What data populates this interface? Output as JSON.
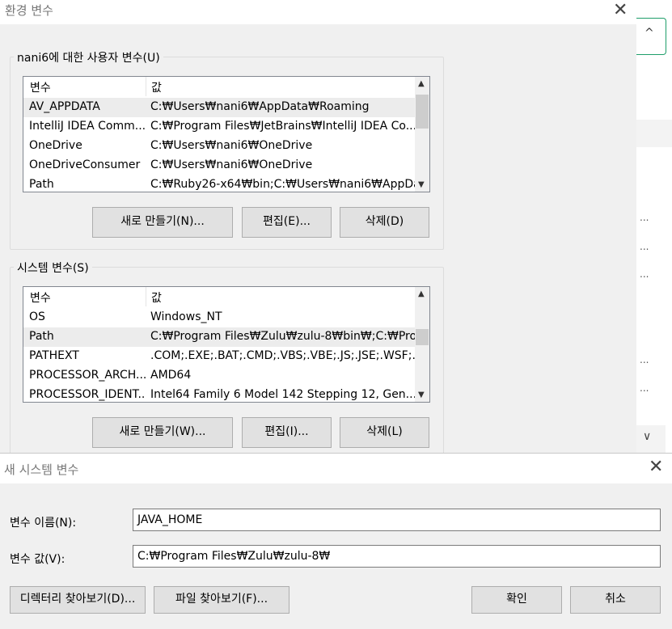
{
  "env_dialog": {
    "title": "환경 변수",
    "close_glyph": "✕",
    "user_group": {
      "label": "nani6에 대한 사용자 변수(U)",
      "columns": [
        "변수",
        "값"
      ],
      "rows": [
        {
          "name": "AV_APPDATA",
          "value": "C:₩Users₩nani6₩AppData₩Roaming"
        },
        {
          "name": "IntelliJ IDEA Comm...",
          "value": "C:₩Program Files₩JetBrains₩IntelliJ IDEA Co..."
        },
        {
          "name": "OneDrive",
          "value": "C:₩Users₩nani6₩OneDrive"
        },
        {
          "name": "OneDriveConsumer",
          "value": "C:₩Users₩nani6₩OneDrive"
        },
        {
          "name": "Path",
          "value": "C:₩Ruby26-x64₩bin;C:₩Users₩nani6₩AppDa..."
        }
      ],
      "buttons": {
        "new": "새로 만들기(N)...",
        "edit": "편집(E)...",
        "delete": "삭제(D)"
      }
    },
    "system_group": {
      "label": "시스템 변수(S)",
      "columns": [
        "변수",
        "값"
      ],
      "rows": [
        {
          "name": "OS",
          "value": "Windows_NT"
        },
        {
          "name": "Path",
          "value": "C:₩Program Files₩Zulu₩zulu-8₩bin₩;C:₩Pro..."
        },
        {
          "name": "PATHEXT",
          "value": ".COM;.EXE;.BAT;.CMD;.VBS;.VBE;.JS;.JSE;.WSF;..."
        },
        {
          "name": "PROCESSOR_ARCH...",
          "value": "AMD64"
        },
        {
          "name": "PROCESSOR_IDENT...",
          "value": "Intel64 Family 6 Model 142 Stepping 12, Gen..."
        }
      ],
      "buttons": {
        "new": "새로 만들기(W)...",
        "edit": "편집(I)...",
        "delete": "삭제(L)"
      }
    }
  },
  "background": {
    "up_glyph": "^",
    "down_glyph": "∨",
    "ellipsis": "..."
  },
  "new_dialog": {
    "title": "새 시스템 변수",
    "close_glyph": "✕",
    "name_label": "변수 이름(N):",
    "value_label": "변수 값(V):",
    "name_value": "JAVA_HOME",
    "value_value": "C:₩Program Files₩Zulu₩zulu-8₩",
    "browse_dir": "디렉터리 찾아보기(D)...",
    "browse_file": "파일 찾아보기(F)...",
    "ok": "확인",
    "cancel": "취소"
  }
}
